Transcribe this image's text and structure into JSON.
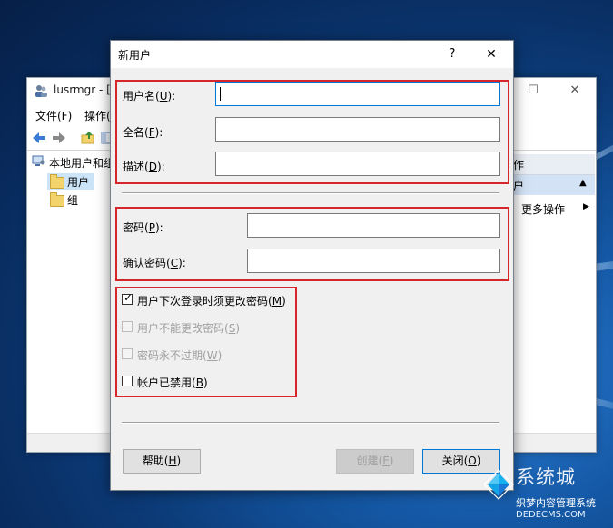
{
  "background_window": {
    "title": "lusrmgr - [",
    "menu": [
      "文件(F)",
      "操作("
    ],
    "tree": {
      "root": "本地用户和组",
      "items": [
        "用户",
        "组"
      ]
    },
    "actions": {
      "header": "作",
      "selected": "户",
      "more": "更多操作"
    }
  },
  "dialog": {
    "title": "新用户",
    "help_symbol": "?",
    "close_symbol": "✕",
    "username": {
      "label": "用户名",
      "key": "U",
      "value": ""
    },
    "fullname": {
      "label": "全名",
      "key": "F",
      "value": ""
    },
    "description": {
      "label": "描述",
      "key": "D",
      "value": ""
    },
    "password": {
      "label": "密码",
      "key": "P",
      "value": ""
    },
    "confirm_password": {
      "label": "确认密码",
      "key": "C",
      "value": ""
    },
    "options": [
      {
        "label": "用户下次登录时须更改密码",
        "key": "M",
        "checked": true,
        "enabled": true
      },
      {
        "label": "用户不能更改密码",
        "key": "S",
        "checked": false,
        "enabled": false
      },
      {
        "label": "密码永不过期",
        "key": "W",
        "checked": false,
        "enabled": false
      },
      {
        "label": "帐户已禁用",
        "key": "B",
        "checked": false,
        "enabled": true
      }
    ],
    "buttons": {
      "help": {
        "label": "帮助",
        "key": "H"
      },
      "create": {
        "label": "创建",
        "key": "E"
      },
      "close": {
        "label": "关闭",
        "key": "O"
      }
    }
  },
  "watermark": {
    "text1": "系统城",
    "text2": "织梦内容管理系统",
    "text3": "DEDECMS.COM"
  },
  "colors": {
    "highlight_box": "#d6262b",
    "focus_border": "#0078d7"
  }
}
